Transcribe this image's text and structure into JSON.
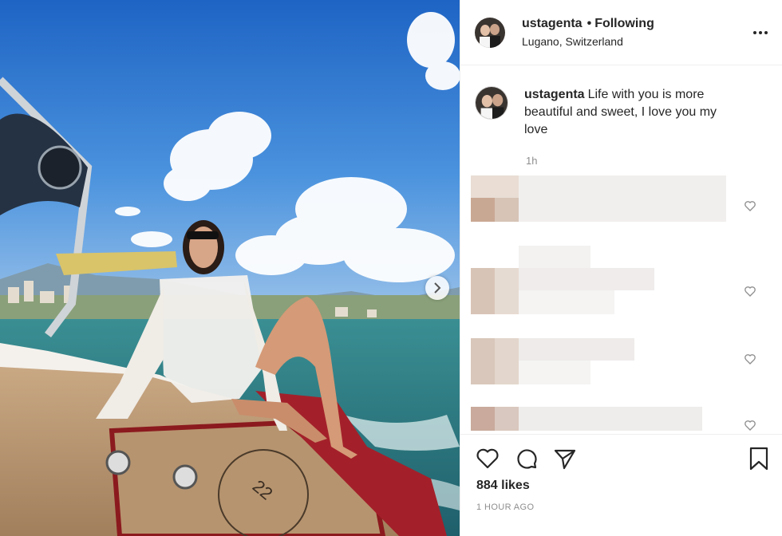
{
  "post": {
    "username": "ustagenta",
    "separator": "•",
    "follow_state": "Following",
    "location": "Lugano, Switzerland",
    "caption_user": "ustagenta",
    "caption_text": "Life with you is more beautiful and sweet, I love you my love",
    "caption_time": "1h",
    "likes": "884 likes",
    "posted_ago": "1 HOUR AGO"
  },
  "icons": {
    "more": "more-options-icon",
    "next": "chevron-right-icon",
    "like": "heart-icon",
    "comment": "comment-icon",
    "share": "paper-plane-icon",
    "save": "bookmark-icon",
    "comment_like": "small-heart-icon"
  },
  "colors": {
    "text": "#262626",
    "muted": "#8e8e8e",
    "border": "#efefef",
    "sky": "#3b7fd0",
    "water": "#2f8a8f"
  },
  "comments": {
    "state": "pixelated / obscured",
    "count_visible": 4
  }
}
